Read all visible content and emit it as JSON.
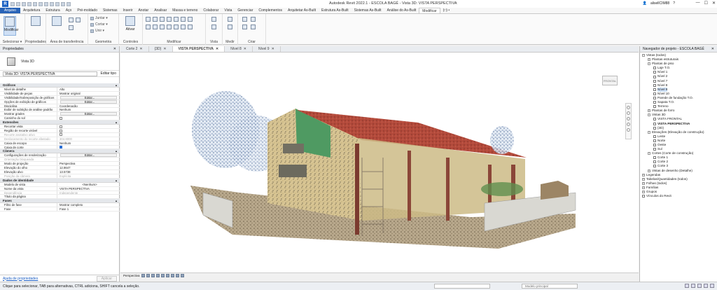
{
  "window": {
    "title": "Autodesk Revit 2022.1 - ESCOLA BAGÉ - Vista 3D: VISTA PERSPECTIVA",
    "user": "alisellCIM88",
    "controls": [
      "—",
      "☐",
      "✕"
    ]
  },
  "ribbon_tabs": [
    "Arquivo",
    "Arquitetura",
    "Estrutura",
    "Aço",
    "Pré-moldado",
    "Sistemas",
    "Inserir",
    "Anotar",
    "Analisar",
    "Massa e terreno",
    "Colaborar",
    "Vista",
    "Gerenciar",
    "Complementos",
    "Arquitetar As-Built",
    "Estrutura As-Built",
    "Sistemas As-Built",
    "Análise do As-Built",
    "Modificar",
    "(□) •"
  ],
  "ribbon": {
    "modify_label": "Modificar",
    "select_label": "Selecionar ▾",
    "panels": [
      "Propriedades",
      "Área de transferência",
      "Geometria",
      "Controles",
      "Modificar",
      "Vista",
      "Medir",
      "Criar"
    ],
    "geometry_rows": [
      "Juntar ▾",
      "Cortar ▾",
      "Unir ▾"
    ],
    "activate_label": "Ativar"
  },
  "properties": {
    "title": "Propriedades",
    "type_name": "Vista 3D",
    "view_selector": "Vista 3D: VISTA PERSPECTIVA",
    "edit_type": "Editar tipo",
    "sections": [
      {
        "name": "Gráficos",
        "rows": [
          {
            "k": "Nível de detalhe",
            "v": "Alto"
          },
          {
            "k": "Visibilidade de peças",
            "v": "Mostrar original"
          },
          {
            "k": "Visibilidade/Sobreposição de gráficos",
            "v": "Editar...",
            "btn": true
          },
          {
            "k": "Opções de exibição de gráficos",
            "v": "Editar...",
            "btn": true
          },
          {
            "k": "Disciplina",
            "v": "Coordenação"
          },
          {
            "k": "Exibir de subtição de análise padrão",
            "v": "Nenhum"
          },
          {
            "k": "Mostrar grades",
            "v": "Editar...",
            "btn": true
          },
          {
            "k": "Caminho do sol",
            "v": "",
            "cb": "off"
          }
        ]
      },
      {
        "name": "Extensões",
        "rows": [
          {
            "k": "Recortar vista",
            "v": "",
            "cb": "off"
          },
          {
            "k": "Região de recorte visível",
            "v": "",
            "cb": "off"
          },
          {
            "k": "Recorte anotativo ativo",
            "v": "",
            "cb": "off",
            "grey": true
          },
          {
            "k": "Deslocamento do recorte afastado",
            "v": "304.8000",
            "grey": true
          },
          {
            "k": "Caixa de escopo",
            "v": "Nenhum"
          },
          {
            "k": "Caixa de corte",
            "v": "",
            "cb": "on"
          }
        ]
      },
      {
        "name": "Câmera",
        "rows": [
          {
            "k": "Configurações de renderização",
            "v": "Editar...",
            "btn": true
          },
          {
            "k": "Orientação bloqueada",
            "v": "",
            "grey": true
          },
          {
            "k": "Modo de projeção",
            "v": "Perspectiva"
          },
          {
            "k": "Elevação do olho",
            "v": "12.8647"
          },
          {
            "k": "Elevação alvo",
            "v": "13.5738"
          },
          {
            "k": "Posição da câmera",
            "v": "Explícita",
            "grey": true
          }
        ]
      },
      {
        "name": "Dados de identidade",
        "rows": [
          {
            "k": "Modelo de vista",
            "v": "<Nenhum>",
            "center": true
          },
          {
            "k": "Nome da vista",
            "v": "VISTA PERSPECTIVA"
          },
          {
            "k": "Dependência",
            "v": "Independente",
            "grey": true
          },
          {
            "k": "Título da página",
            "v": ""
          }
        ]
      },
      {
        "name": "Fases",
        "rows": [
          {
            "k": "Filtro de fase",
            "v": "Mostrar completo"
          },
          {
            "k": "Fase",
            "v": "Fase 1"
          }
        ]
      }
    ],
    "help_link": "Ajuda de propriedades",
    "apply": "Aplicar"
  },
  "view_tabs": [
    {
      "label": "Corte 2",
      "active": false
    },
    {
      "label": "{3D}",
      "active": false
    },
    {
      "label": "VISTA PERSPECTIVA",
      "active": true
    },
    {
      "label": "Nível 8",
      "active": false
    },
    {
      "label": "Nível 9",
      "active": false
    }
  ],
  "viewcube_label": "FRONTAL",
  "view_control": {
    "label": "Perspectiva"
  },
  "browser": {
    "title": "Navegador de projeto - ESCOLA BAGÉ",
    "nodes": [
      {
        "label": "Vistas (todos)",
        "lvl": 0,
        "tg": "−"
      },
      {
        "label": "Plantas estruturais",
        "lvl": 1,
        "tg": "+"
      },
      {
        "label": "Plantas de piso",
        "lvl": 1,
        "tg": "−"
      },
      {
        "label": "Laje T.O.",
        "lvl": 2
      },
      {
        "label": "Nível 1",
        "lvl": 2
      },
      {
        "label": "Nível 2",
        "lvl": 2
      },
      {
        "label": "Nível 7",
        "lvl": 2
      },
      {
        "label": "Nível 8",
        "lvl": 2
      },
      {
        "label": "Nível 9",
        "lvl": 2,
        "sel": true
      },
      {
        "label": "Nível 10",
        "lvl": 2
      },
      {
        "label": "Parede de fundação T.O.",
        "lvl": 2
      },
      {
        "label": "Sapata T.O.",
        "lvl": 2
      },
      {
        "label": "Terreno",
        "lvl": 2
      },
      {
        "label": "Plantas de forro",
        "lvl": 1,
        "tg": "+"
      },
      {
        "label": "Vistas 3D",
        "lvl": 1,
        "tg": "−"
      },
      {
        "label": "VISTA FRONTAL",
        "lvl": 2
      },
      {
        "label": "VISTA PERSPECTIVA",
        "lvl": 2,
        "bold": true
      },
      {
        "label": "{3D}",
        "lvl": 2
      },
      {
        "label": "Elevações (Elevação de construção)",
        "lvl": 1,
        "tg": "−"
      },
      {
        "label": "Leste",
        "lvl": 2
      },
      {
        "label": "Norte",
        "lvl": 2
      },
      {
        "label": "Oeste",
        "lvl": 2
      },
      {
        "label": "Sul",
        "lvl": 2
      },
      {
        "label": "Cortes (Corte de construção)",
        "lvl": 1,
        "tg": "−"
      },
      {
        "label": "Corte 1",
        "lvl": 2
      },
      {
        "label": "Corte 2",
        "lvl": 2
      },
      {
        "label": "Corte 3",
        "lvl": 2
      },
      {
        "label": "Vistas de desenho (Detalhe)",
        "lvl": 1,
        "tg": "+"
      },
      {
        "label": "Legendas",
        "lvl": 0,
        "tg": "+"
      },
      {
        "label": "Tabelas/Quantidades (todos)",
        "lvl": 0,
        "tg": "+"
      },
      {
        "label": "Folhas (todos)",
        "lvl": 0,
        "tg": "+"
      },
      {
        "label": "Famílias",
        "lvl": 0,
        "tg": "+"
      },
      {
        "label": "Grupos",
        "lvl": 0,
        "tg": "+"
      },
      {
        "label": "Vínculos do Revit",
        "lvl": 0
      }
    ]
  },
  "status": {
    "hint": "Clique para selecionar, TAB para alternativas, CTRL adiciona, SHIFT cancela a seleção.",
    "model": "Modelo principal",
    "scale": "0"
  },
  "colors": {
    "accent": "#2863b7",
    "roof": "#b0483a",
    "wall": "#d9c48a"
  }
}
